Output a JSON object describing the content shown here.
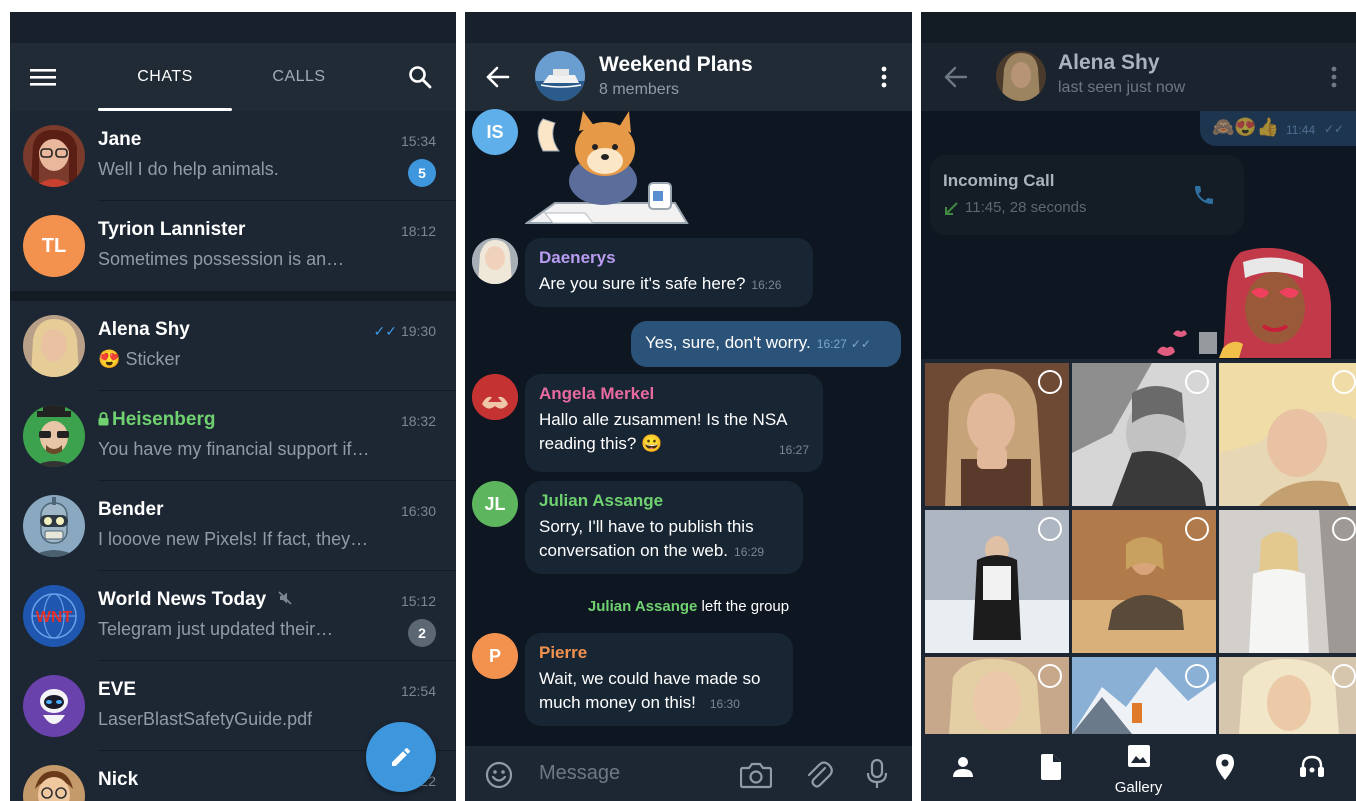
{
  "colors": {
    "accent": "#3e96dd",
    "panel": "#1d2733",
    "header": "#202b36",
    "chat_bg": "#0e1621",
    "online_green": "#6fd16f"
  },
  "screen1": {
    "tabs": {
      "chats": "CHATS",
      "calls": "CALLS"
    },
    "chats": [
      {
        "name": "Jane",
        "preview": "Well I do help animals.",
        "time": "15:34",
        "badge": "5"
      },
      {
        "name": "Tyrion Lannister",
        "initials": "TL",
        "preview": "Sometimes possession is an…",
        "time": "18:12"
      },
      {
        "name": "Alena Shy",
        "preview_emoji": "😍",
        "preview": "Sticker",
        "time": "19:30",
        "read_ticks": "✓✓"
      },
      {
        "name": "Heisenberg",
        "lock_icon": "lock-icon",
        "preview": "You have my financial support if…",
        "time": "18:32"
      },
      {
        "name": "Bender",
        "preview": "I looove new Pixels! If fact, they…",
        "time": "16:30"
      },
      {
        "name": "World News Today",
        "muted_icon": "mute-icon",
        "avatar_text": "WNT",
        "preview": "Telegram just updated their…",
        "time": "15:12",
        "badge": "2"
      },
      {
        "name": "EVE",
        "preview": "LaserBlastSafetyGuide.pdf",
        "time": "12:54"
      },
      {
        "name": "Nick",
        "preview": "",
        "time": "12:22"
      }
    ]
  },
  "screen2": {
    "title": "Weekend Plans",
    "subtitle": "8 members",
    "messages": {
      "sticker_sender_initials": "IS",
      "daenerys": {
        "sender": "Daenerys",
        "text": "Are you sure it's safe here?",
        "time": "16:26"
      },
      "outgoing": {
        "text": "Yes, sure, don't worry.",
        "time": "16:27",
        "ticks": "✓✓"
      },
      "angela": {
        "sender": "Angela Merkel",
        "text1": "Hallo alle zusammen! Is the NSA",
        "text2": "reading this?",
        "emoji": "😀",
        "time": "16:27"
      },
      "julian": {
        "sender": "Julian Assange",
        "initials": "JL",
        "text1": "Sorry, I'll have to publish this",
        "text2": "conversation on the web.",
        "time": "16:29"
      },
      "service": {
        "name": "Julian Assange",
        "text": "left the group"
      },
      "pierre": {
        "sender": "Pierre",
        "initials": "P",
        "text1": "Wait, we could have made so",
        "text2": "much money on this!",
        "time": "16:30"
      }
    },
    "input_placeholder": "Message"
  },
  "screen3": {
    "peer_name": "Alena Shy",
    "peer_status": "last seen just now",
    "emoji_message": {
      "emojis": "🙈😍👍",
      "time": "11:44",
      "ticks": "✓✓"
    },
    "call": {
      "title": "Incoming Call",
      "detail": "11:45, 28 seconds"
    },
    "bottom_tabs": {
      "gallery": "Gallery"
    }
  }
}
